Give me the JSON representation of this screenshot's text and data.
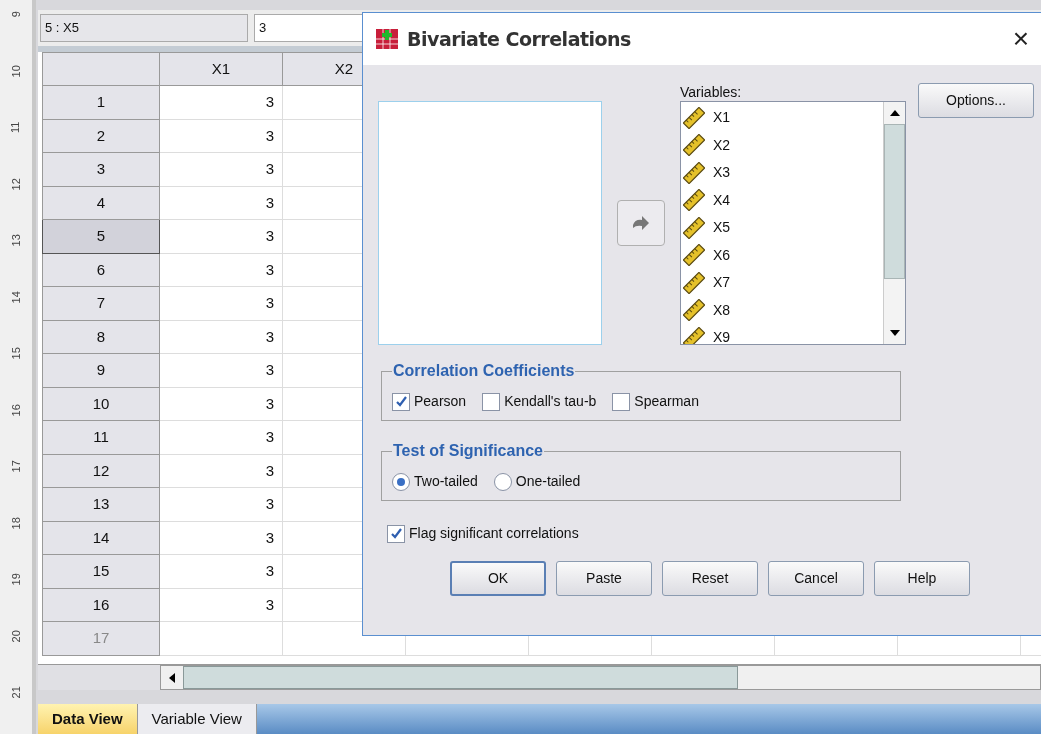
{
  "ruler": [
    "9",
    "10",
    "11",
    "12",
    "13",
    "14",
    "15",
    "16",
    "17",
    "18",
    "19",
    "20",
    "21"
  ],
  "cell_ref": "5 : X5",
  "cell_value": "3",
  "columns": [
    "X1",
    "X2"
  ],
  "rows": [
    {
      "label": "1",
      "cells": [
        "3"
      ],
      "selected": false,
      "disabled": false
    },
    {
      "label": "2",
      "cells": [
        "3"
      ],
      "selected": false,
      "disabled": false
    },
    {
      "label": "3",
      "cells": [
        "3"
      ],
      "selected": false,
      "disabled": false
    },
    {
      "label": "4",
      "cells": [
        "3"
      ],
      "selected": false,
      "disabled": false
    },
    {
      "label": "5",
      "cells": [
        "3"
      ],
      "selected": true,
      "disabled": false
    },
    {
      "label": "6",
      "cells": [
        "3"
      ],
      "selected": false,
      "disabled": false
    },
    {
      "label": "7",
      "cells": [
        "3"
      ],
      "selected": false,
      "disabled": false
    },
    {
      "label": "8",
      "cells": [
        "3"
      ],
      "selected": false,
      "disabled": false
    },
    {
      "label": "9",
      "cells": [
        "3"
      ],
      "selected": false,
      "disabled": false
    },
    {
      "label": "10",
      "cells": [
        "3"
      ],
      "selected": false,
      "disabled": false
    },
    {
      "label": "11",
      "cells": [
        "3"
      ],
      "selected": false,
      "disabled": false
    },
    {
      "label": "12",
      "cells": [
        "3"
      ],
      "selected": false,
      "disabled": false
    },
    {
      "label": "13",
      "cells": [
        "3"
      ],
      "selected": false,
      "disabled": false
    },
    {
      "label": "14",
      "cells": [
        "3"
      ],
      "selected": false,
      "disabled": false
    },
    {
      "label": "15",
      "cells": [
        "3"
      ],
      "selected": false,
      "disabled": false
    },
    {
      "label": "16",
      "cells": [
        "3"
      ],
      "selected": false,
      "disabled": false
    },
    {
      "label": "17",
      "cells": [],
      "selected": false,
      "disabled": true
    }
  ],
  "tabs": [
    {
      "label": "Data View",
      "selected": true
    },
    {
      "label": "Variable View",
      "selected": false
    }
  ],
  "dialog": {
    "title": "Bivariate Correlations",
    "close": "×",
    "variables_label": "Variables:",
    "variables": [
      "X1",
      "X2",
      "X3",
      "X4",
      "X5",
      "X6",
      "X7",
      "X8",
      "X9"
    ],
    "options_button": "Options...",
    "coefficients": {
      "title": "Correlation Coefficients",
      "items": [
        {
          "label": "Pearson",
          "checked": true
        },
        {
          "label": "Kendall's tau-b",
          "checked": false
        },
        {
          "label": "Spearman",
          "checked": false
        }
      ]
    },
    "significance": {
      "title": "Test of Significance",
      "items": [
        {
          "label": "Two-tailed",
          "selected": true
        },
        {
          "label": "One-tailed",
          "selected": false
        }
      ]
    },
    "flag": {
      "label": "Flag significant correlations",
      "checked": true
    },
    "buttons": [
      {
        "label": "OK",
        "default": true
      },
      {
        "label": "Paste",
        "default": false
      },
      {
        "label": "Reset",
        "default": false
      },
      {
        "label": "Cancel",
        "default": false
      },
      {
        "label": "Help",
        "default": false
      }
    ]
  }
}
